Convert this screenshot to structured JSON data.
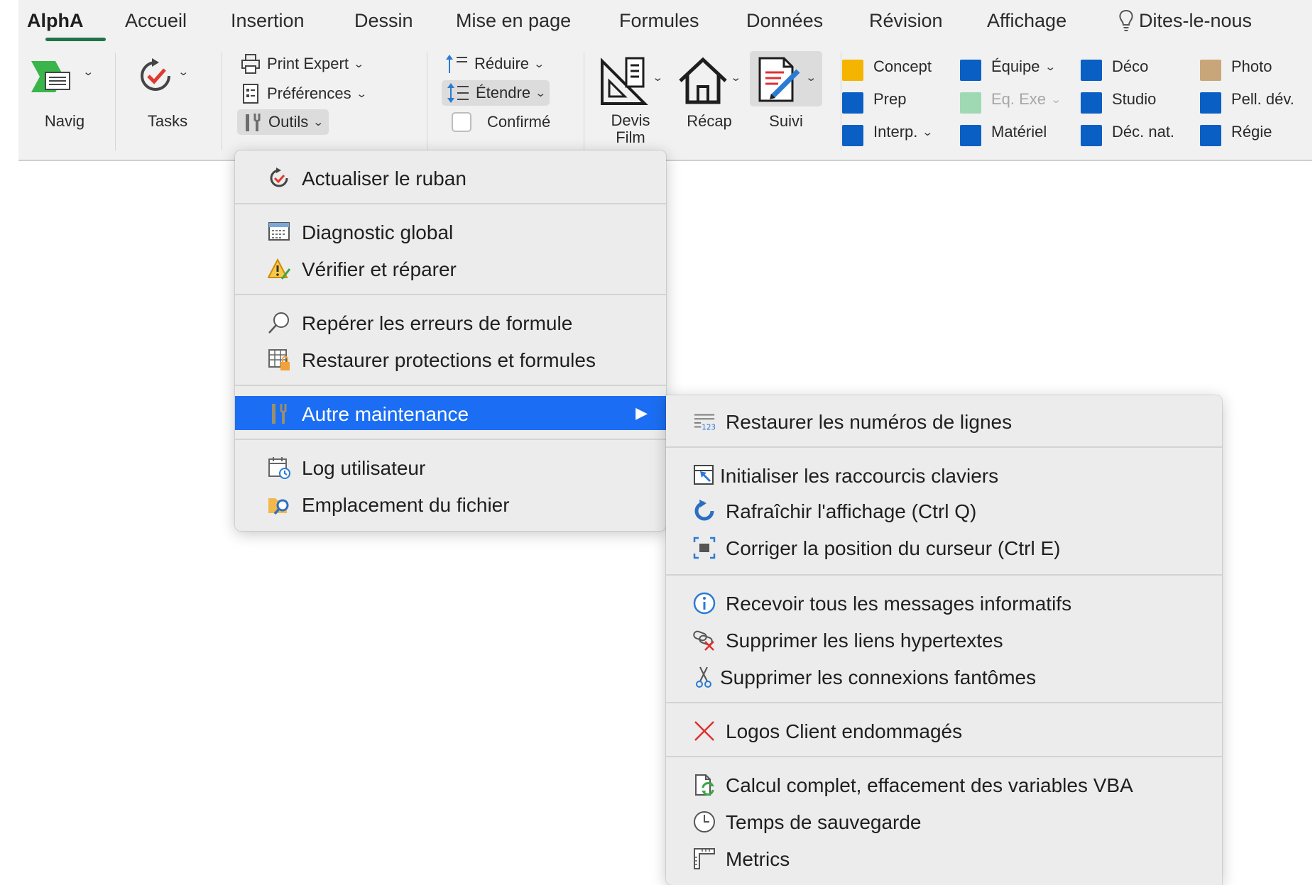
{
  "tabs": [
    {
      "label": "AlphA",
      "active": true
    },
    {
      "label": "Accueil"
    },
    {
      "label": "Insertion"
    },
    {
      "label": "Dessin"
    },
    {
      "label": "Mise en page"
    },
    {
      "label": "Formules"
    },
    {
      "label": "Données"
    },
    {
      "label": "Révision"
    },
    {
      "label": "Affichage"
    },
    {
      "label": "Dites-le-nous"
    }
  ],
  "ribbon": {
    "navig_label": "Navig",
    "tasks_label": "Tasks",
    "print_expert": "Print Expert",
    "preferences": "Préférences",
    "outils": "Outils",
    "reduire": "Réduire",
    "etendre": "Étendre",
    "confirme": "Confirmé",
    "devis_film_1": "Devis",
    "devis_film_2": "Film",
    "recap": "Récap",
    "suivi": "Suivi",
    "swatches": [
      {
        "label": "Concept",
        "color": "#f5b400"
      },
      {
        "label": "Prep",
        "color": "#0a5fc4"
      },
      {
        "label": "Interp.",
        "color": "#0a5fc4",
        "dropdown": true
      },
      {
        "label": "Équipe",
        "color": "#0a5fc4",
        "dropdown": true
      },
      {
        "label": "Eq. Exe",
        "color": "#9fd9b4",
        "dropdown": true,
        "disabled": true
      },
      {
        "label": "Matériel",
        "color": "#0a5fc4"
      },
      {
        "label": "Déco",
        "color": "#0a5fc4"
      },
      {
        "label": "Studio",
        "color": "#0a5fc4"
      },
      {
        "label": "Déc. nat.",
        "color": "#0a5fc4"
      },
      {
        "label": "Photo",
        "color": "#c9a67a"
      },
      {
        "label": "Pell. dév.",
        "color": "#0a5fc4"
      },
      {
        "label": "Régie",
        "color": "#0a5fc4"
      }
    ]
  },
  "outils_menu": {
    "items": [
      {
        "label": "Actualiser le ruban",
        "icon": "refresh-check-icon"
      },
      {
        "label": "Diagnostic global",
        "icon": "diagnostic-icon"
      },
      {
        "label": "Vérifier et réparer",
        "icon": "warning-repair-icon"
      },
      {
        "label": "Repérer les erreurs de formule",
        "icon": "magnifier-icon"
      },
      {
        "label": "Restaurer protections et formules",
        "icon": "table-lock-icon"
      },
      {
        "label": "Autre maintenance",
        "icon": "tools-icon",
        "highlighted": true,
        "submenu": true
      },
      {
        "label": "Log utilisateur",
        "icon": "calendar-clock-icon"
      },
      {
        "label": "Emplacement du fichier",
        "icon": "folder-search-icon"
      }
    ]
  },
  "maintenance_submenu": {
    "items": [
      {
        "label": "Restaurer les numéros de lignes",
        "icon": "line-numbers-icon"
      },
      {
        "label": "Initialiser les raccourcis claviers",
        "icon": "shortcut-icon"
      },
      {
        "label": "Rafraîchir l'affichage (Ctrl Q)",
        "icon": "refresh-icon"
      },
      {
        "label": "Corriger la position du curseur (Ctrl E)",
        "icon": "cursor-position-icon"
      },
      {
        "label": "Recevoir tous les messages informatifs",
        "icon": "info-icon"
      },
      {
        "label": "Supprimer les liens hypertextes",
        "icon": "unlink-icon"
      },
      {
        "label": "Supprimer les connexions fantômes",
        "icon": "scissors-icon"
      },
      {
        "label": "Logos Client endommagés",
        "icon": "red-x-icon"
      },
      {
        "label": "Calcul complet, effacement des variables VBA",
        "icon": "recalc-icon"
      },
      {
        "label": "Temps de sauvegarde",
        "icon": "clock-icon"
      },
      {
        "label": "Metrics",
        "icon": "ruler-icon"
      }
    ]
  },
  "colors": {
    "accent": "#1b6ef3",
    "tab_underline": "#217346",
    "ribbon_bg": "#f1f1f1",
    "menu_bg": "#ececec"
  }
}
